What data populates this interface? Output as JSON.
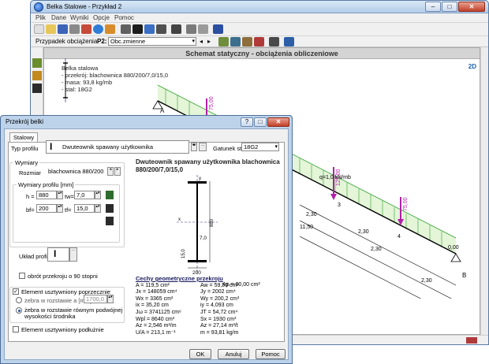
{
  "main_window": {
    "title": "Belka Stalowe - Przykład 2",
    "menu": [
      "Plik",
      "Dane",
      "Wyniki",
      "Opcje",
      "Pomoc"
    ],
    "toolbar2": {
      "load_case_label": "Przypadek obciążenia",
      "load_case_code": "P2:",
      "load_case_value": "Obc.zmienne"
    },
    "canvas_header": "Schemat statyczny - obciążenia obliczeniowe",
    "beam_info": {
      "title": "Belka stalowa",
      "lines": [
        "- przekrój: blachownica 880/200/7,0/15,0",
        "- masa: 93,8 kg/mb",
        "- stal: 18G2"
      ]
    },
    "view_mode": "2D",
    "diagram": {
      "support_left": "A",
      "support_right": "B",
      "load_value": "q=1,0 kN/mb",
      "point_loads": [
        "75,00",
        "125,00",
        "75,00"
      ],
      "dims": [
        "2,30",
        "2,30",
        "11,50",
        "2,30",
        "2,30"
      ],
      "nodes": [
        "2",
        "3",
        "4"
      ],
      "end_value": "0,00"
    }
  },
  "dialog": {
    "title": "Przekrój belki",
    "tab": "Stalowy",
    "profile_type_label": "Typ profilu",
    "profile_type_value": "Dwuteownik spawany użytkownika",
    "steel_grade_label": "Gatunek stali",
    "steel_grade_value": "18G2",
    "dims_group": "Wymiary",
    "size_label": "Rozmiar",
    "size_value": "blachownica 880/200",
    "profile_dims_group": "Wymiary profilu [mm]",
    "fields": [
      {
        "label": "h =",
        "value": "880"
      },
      {
        "label": "tw=",
        "value": "7,0"
      },
      {
        "label": "bf=",
        "value": "200"
      },
      {
        "label": "tf=",
        "value": "15,0"
      }
    ],
    "layout_label": "Układ profili",
    "rotate_label": "obrót przekroju o 90 stopni",
    "transverse_label": "Element usztywniony poprzecznie",
    "ribs_spacing_label": "żebra w rozstawie a [mm] =",
    "ribs_spacing_value": "1700,0",
    "ribs_equal_label_1": "żebra w rozstawie równym podwójnej",
    "ribs_equal_label_2": "wysokości środnika",
    "longitudinal_label": "Element usztywniony podłużnie",
    "section_title_1": "Dwuteownik spawany użytkownika blachownica",
    "section_title_2": "880/200/7,0/15,0",
    "drawing": {
      "y": "y",
      "x": "x",
      "tw": "7,0",
      "tf": "15,0",
      "bf": "200",
      "h": "880"
    },
    "props_title": "Cechy geometryczne przekroju",
    "props": [
      [
        "A = 119,5 cm²",
        "Aw = 59,50 cm²"
      ],
      [
        "Jx = 148059 cm⁴",
        "Jy = 2002 cm⁴"
      ],
      [
        "Wx = 3365 cm³",
        "Wy = 200,2 cm³"
      ],
      [
        "ix = 35,20 cm",
        "iy = 4,093 cm"
      ],
      [
        "Jω = 3741125 cm⁶",
        "JT = 54,72 cm⁴"
      ],
      [
        "Wpl = 8640 cm³",
        "Sx = 1930 cm³"
      ],
      [
        "Az = 2,546 m²/m",
        "Az = 27,14 m²/t"
      ],
      [
        "U/A = 213,1 m⁻¹",
        "m = 93,81 kg/m"
      ]
    ],
    "props_extra": "Ap = 60,00 cm²",
    "buttons": {
      "ok": "OK",
      "cancel": "Anuluj",
      "help": "Pomoc"
    }
  }
}
